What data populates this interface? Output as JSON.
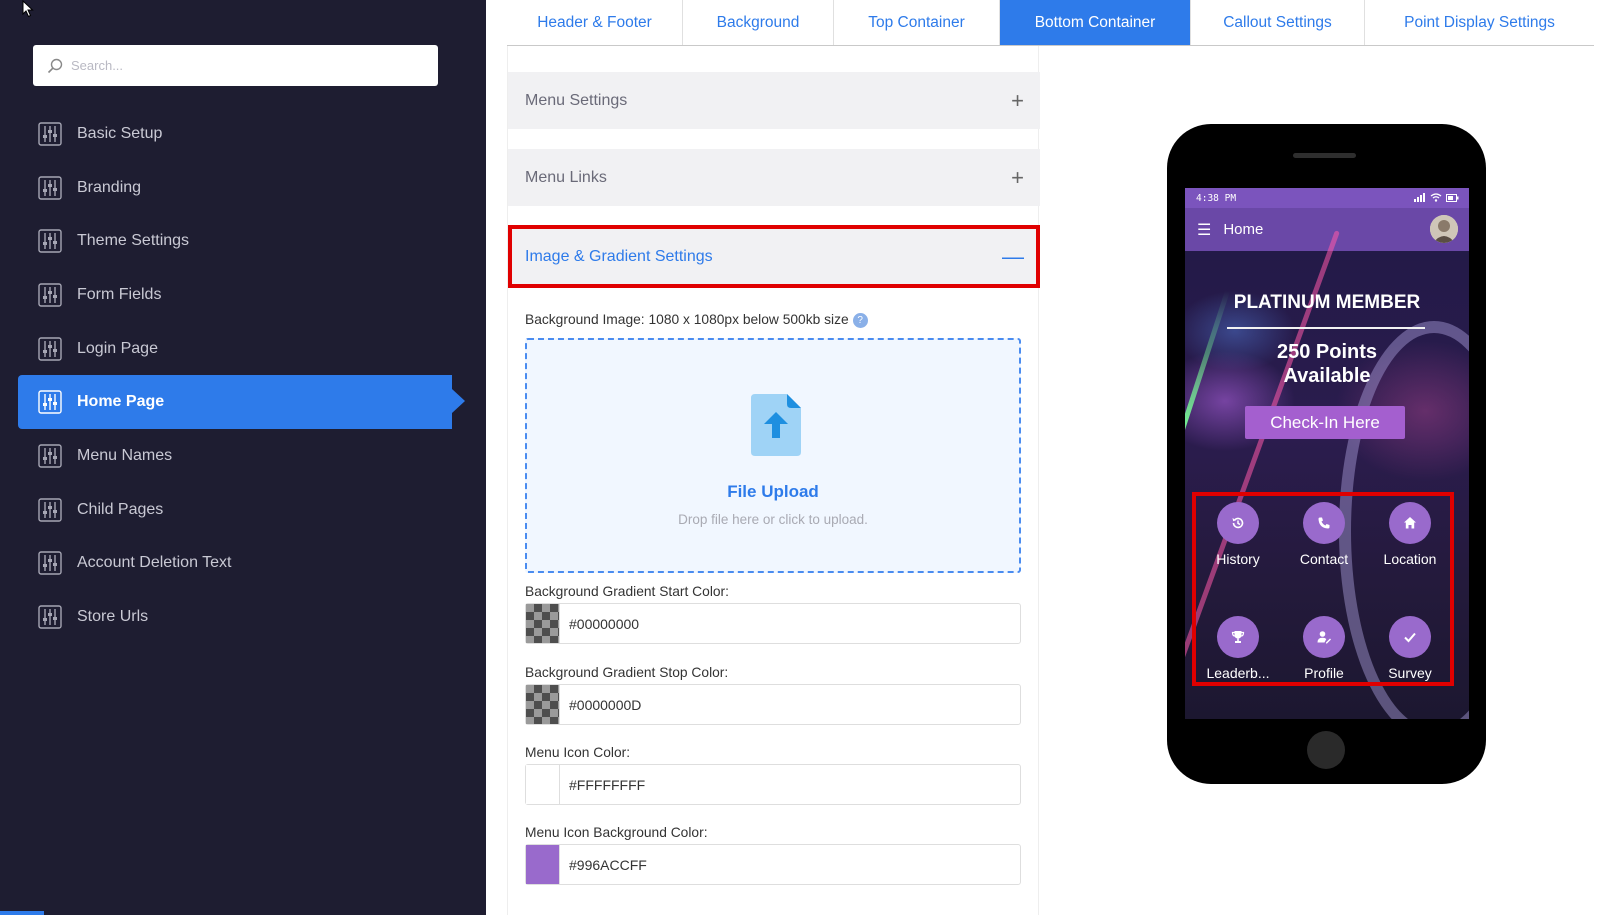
{
  "search": {
    "placeholder": "Search..."
  },
  "sidebar": {
    "items": [
      {
        "label": "Basic Setup"
      },
      {
        "label": "Branding"
      },
      {
        "label": "Theme Settings"
      },
      {
        "label": "Form Fields"
      },
      {
        "label": "Login Page"
      },
      {
        "label": "Home Page"
      },
      {
        "label": "Menu Names"
      },
      {
        "label": "Child Pages"
      },
      {
        "label": "Account Deletion Text"
      },
      {
        "label": "Store Urls"
      }
    ],
    "active": "Home Page"
  },
  "tabs": [
    {
      "label": "Header & Footer"
    },
    {
      "label": "Background"
    },
    {
      "label": "Top Container"
    },
    {
      "label": "Bottom Container"
    },
    {
      "label": "Callout Settings"
    },
    {
      "label": "Point Display Settings"
    }
  ],
  "active_tab": "Bottom Container",
  "accordions": {
    "menu_settings": {
      "title": "Menu Settings",
      "sign": "+"
    },
    "menu_links": {
      "title": "Menu Links",
      "sign": "+"
    },
    "image_gradient": {
      "title": "Image & Gradient Settings",
      "sign": "—"
    }
  },
  "form": {
    "bg_image_label": "Background Image: 1080 x 1080px below 500kb size",
    "help": "?",
    "upload_title": "File Upload",
    "upload_hint": "Drop file here or click to upload.",
    "gradient_start_label": "Background Gradient Start Color:",
    "gradient_start_value": "#00000000",
    "gradient_stop_label": "Background Gradient Stop Color:",
    "gradient_stop_value": "#0000000D",
    "menu_icon_color_label": "Menu Icon Color:",
    "menu_icon_color_value": "#FFFFFFFF",
    "menu_icon_bg_label": "Menu Icon Background Color:",
    "menu_icon_bg_value": "#996ACCFF"
  },
  "colors": {
    "accent": "#2e7bea",
    "sidebar_bg": "#1e1d31",
    "highlight": "#e00000",
    "menu_icon_bg": "#996acc"
  },
  "phone": {
    "time": "4:38 PM",
    "title": "Home",
    "member": "PLATINUM MEMBER",
    "points_line1": "250 Points",
    "points_line2": "Available",
    "cta": "Check-In Here",
    "menu": [
      {
        "label": "History",
        "icon": "history-icon"
      },
      {
        "label": "Contact",
        "icon": "phone-icon"
      },
      {
        "label": "Location",
        "icon": "home-icon"
      },
      {
        "label": "Leaderb...",
        "icon": "trophy-icon"
      },
      {
        "label": "Profile",
        "icon": "profile-icon"
      },
      {
        "label": "Survey",
        "icon": "check-icon"
      }
    ]
  }
}
